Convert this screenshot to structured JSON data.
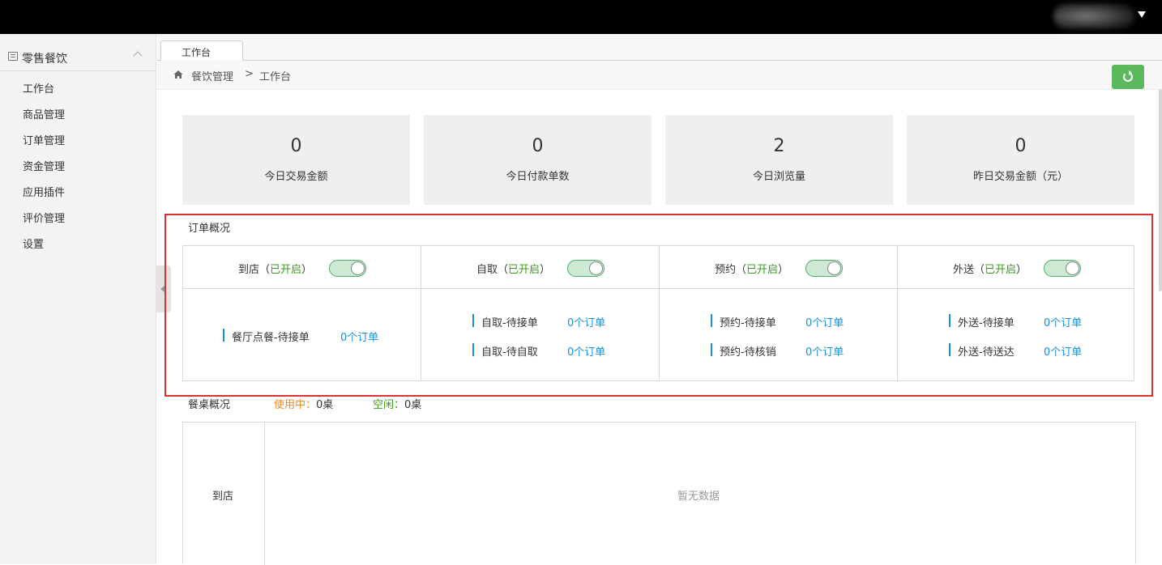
{
  "sidebar": {
    "title": "零售餐饮",
    "items": [
      "工作台",
      "商品管理",
      "订单管理",
      "资金管理",
      "应用插件",
      "评价管理",
      "设置"
    ]
  },
  "tabs": [
    {
      "label": "工作台"
    }
  ],
  "breadcrumb": {
    "parent": "餐饮管理",
    "separator": ">",
    "current": "工作台"
  },
  "stats": [
    {
      "value": "0",
      "label": "今日交易金额"
    },
    {
      "value": "0",
      "label": "今日付款单数"
    },
    {
      "value": "2",
      "label": "今日浏览量"
    },
    {
      "value": "0",
      "label": "昨日交易金额（元）"
    }
  ],
  "order_overview": {
    "title": "订单概况",
    "columns": [
      {
        "name": "到店（",
        "status": "已开启",
        "close": "）",
        "enabled": true,
        "rows": [
          {
            "label": "餐厅点餐-待接单",
            "count": "0个订单"
          }
        ]
      },
      {
        "name": "自取（",
        "status": "已开启",
        "close": "）",
        "enabled": true,
        "rows": [
          {
            "label": "自取-待接单",
            "count": "0个订单"
          },
          {
            "label": "自取-待自取",
            "count": "0个订单"
          }
        ]
      },
      {
        "name": "预约（",
        "status": "已开启",
        "close": "）",
        "enabled": true,
        "rows": [
          {
            "label": "预约-待接单",
            "count": "0个订单"
          },
          {
            "label": "预约-待核销",
            "count": "0个订单"
          }
        ]
      },
      {
        "name": "外送（",
        "status": "已开启",
        "close": "）",
        "enabled": true,
        "rows": [
          {
            "label": "外送-待接单",
            "count": "0个订单"
          },
          {
            "label": "外送-待送达",
            "count": "0个订单"
          }
        ]
      }
    ]
  },
  "table_overview": {
    "title": "餐桌概况",
    "in_use_label": "使用中：",
    "in_use_value": "0桌",
    "idle_label": "空闲：",
    "idle_value": "0桌",
    "row_label": "到店",
    "empty_text": "暂无数据"
  },
  "colors": {
    "accent_green": "#5cb85c",
    "link_blue": "#1a8fd6",
    "status_green": "#3c9a1c",
    "in_use_orange": "#f08a24",
    "highlight_red": "#e03030"
  }
}
